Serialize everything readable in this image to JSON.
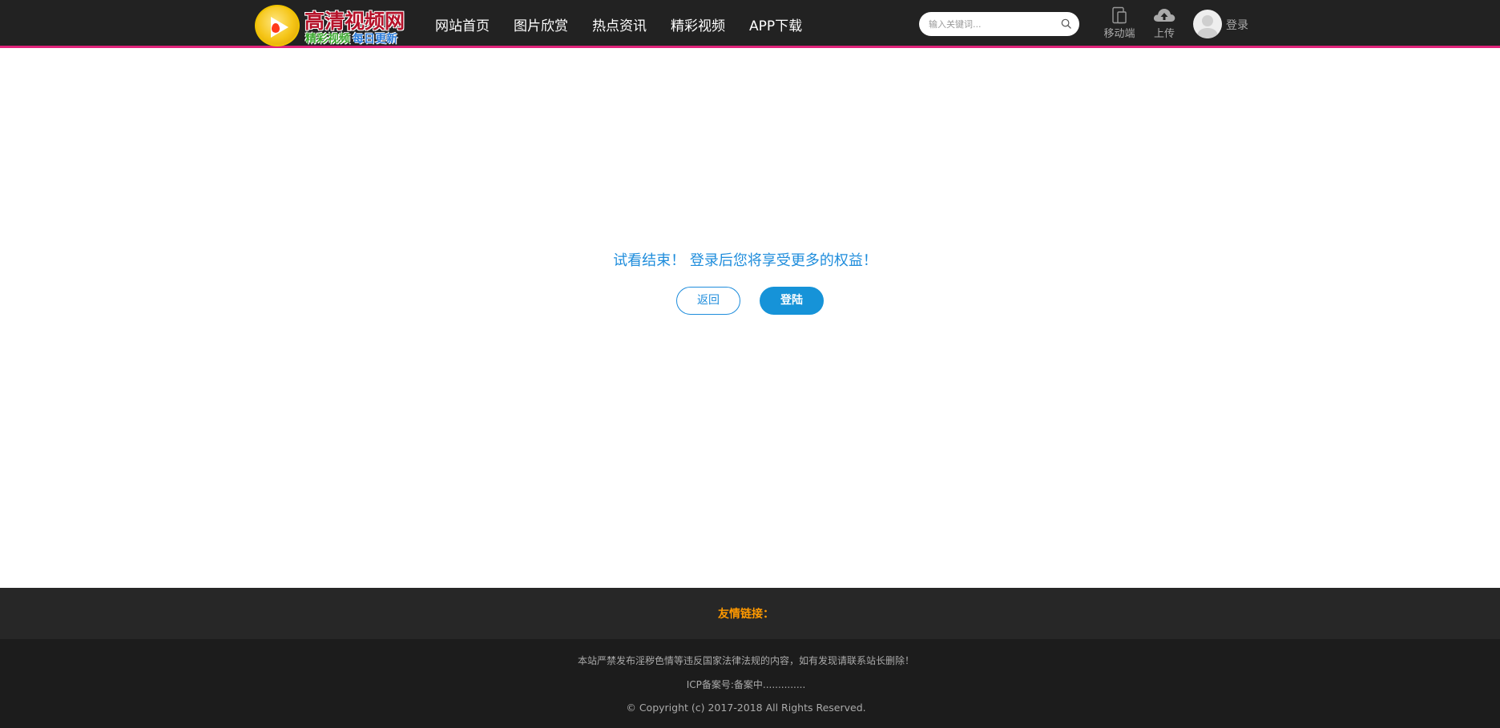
{
  "header": {
    "logo": {
      "title": "高清视频网",
      "sub1": "精彩视频",
      "sub2": "每日更新"
    },
    "nav": [
      "网站首页",
      "图片欣赏",
      "热点资讯",
      "精彩视频",
      "APP下载"
    ],
    "search": {
      "placeholder": "输入关键词..."
    },
    "mobile_label": "移动端",
    "upload_label": "上传",
    "login_label": "登录"
  },
  "main": {
    "message": "试看结束！ 登录后您将享受更多的权益！",
    "back_label": "返回",
    "login_button_label": "登陆"
  },
  "footer": {
    "friend_links": "友情链接：",
    "notice": "本站严禁发布淫秽色情等违反国家法律法规的内容，如有发现请联系站长删除！",
    "icp": "ICP备案号:备案中..............",
    "copyright": "© Copyright (c) 2017-2018 All Rights Reserved."
  },
  "colors": {
    "header_bg": "#222222",
    "header_border": "#e0237a",
    "accent_blue": "#1f8ddc",
    "friend_link_orange": "#ff9900"
  },
  "icons": [
    "search-icon",
    "mobile-icon",
    "cloud-upload-icon",
    "avatar-icon"
  ]
}
